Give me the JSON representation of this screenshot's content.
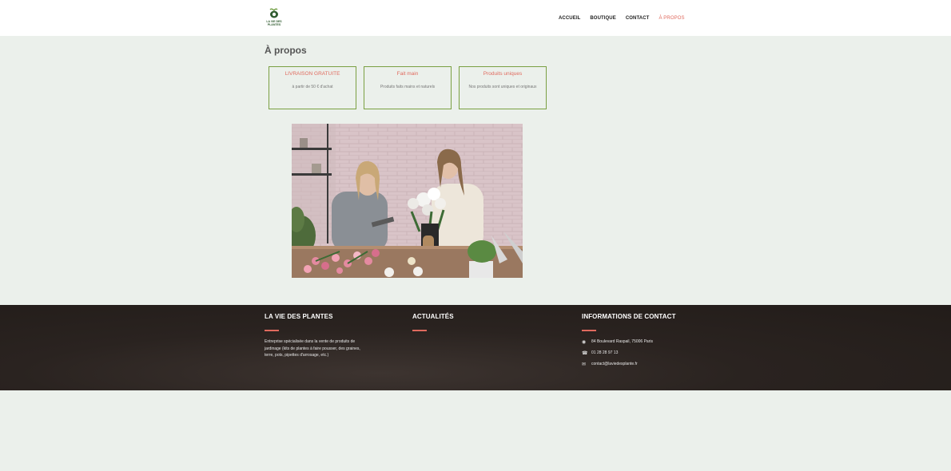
{
  "brand": {
    "name": "LA VIE DES PLANTES",
    "logo_line1": "LA VIE DES",
    "logo_line2": "PLANTES"
  },
  "nav": [
    {
      "label": "ACCUEIL",
      "active": false
    },
    {
      "label": "BOUTIQUE",
      "active": false
    },
    {
      "label": "CONTACT",
      "active": false
    },
    {
      "label": "À PROPOS",
      "active": true
    }
  ],
  "page": {
    "title": "À propos"
  },
  "features": [
    {
      "title": "LIVRAISON GRATUITE",
      "desc": "à partir de 50 € d'achat"
    },
    {
      "title": "Fait main",
      "desc": "Produits faits mains et naturels"
    },
    {
      "title": "Produits uniques",
      "desc": "Nos produits sont uniques et originaux"
    }
  ],
  "footer": {
    "about": {
      "heading": "LA VIE DES PLANTES",
      "text": "Entreprise spécialisée dans la vente de produits de jardinage (kits de plantes à faire pousser, des graines, terre, pots, pipettes d'arrosage, etc.)"
    },
    "news": {
      "heading": "ACTUALITÉS"
    },
    "contact": {
      "heading": "INFORMATIONS DE CONTACT",
      "address": "84 Boulevard Raspail, 75006 Paris",
      "phone": "01 28 28 97 13",
      "email": "contact@laviedesplante.fr"
    }
  },
  "colors": {
    "accent": "#e06a5e",
    "box_border": "#7aa042",
    "background": "#ebf0eb",
    "footer_bg": "#2a2320"
  },
  "icons": [
    "logo-leaf-icon",
    "map-pin-icon",
    "phone-icon",
    "envelope-icon"
  ]
}
